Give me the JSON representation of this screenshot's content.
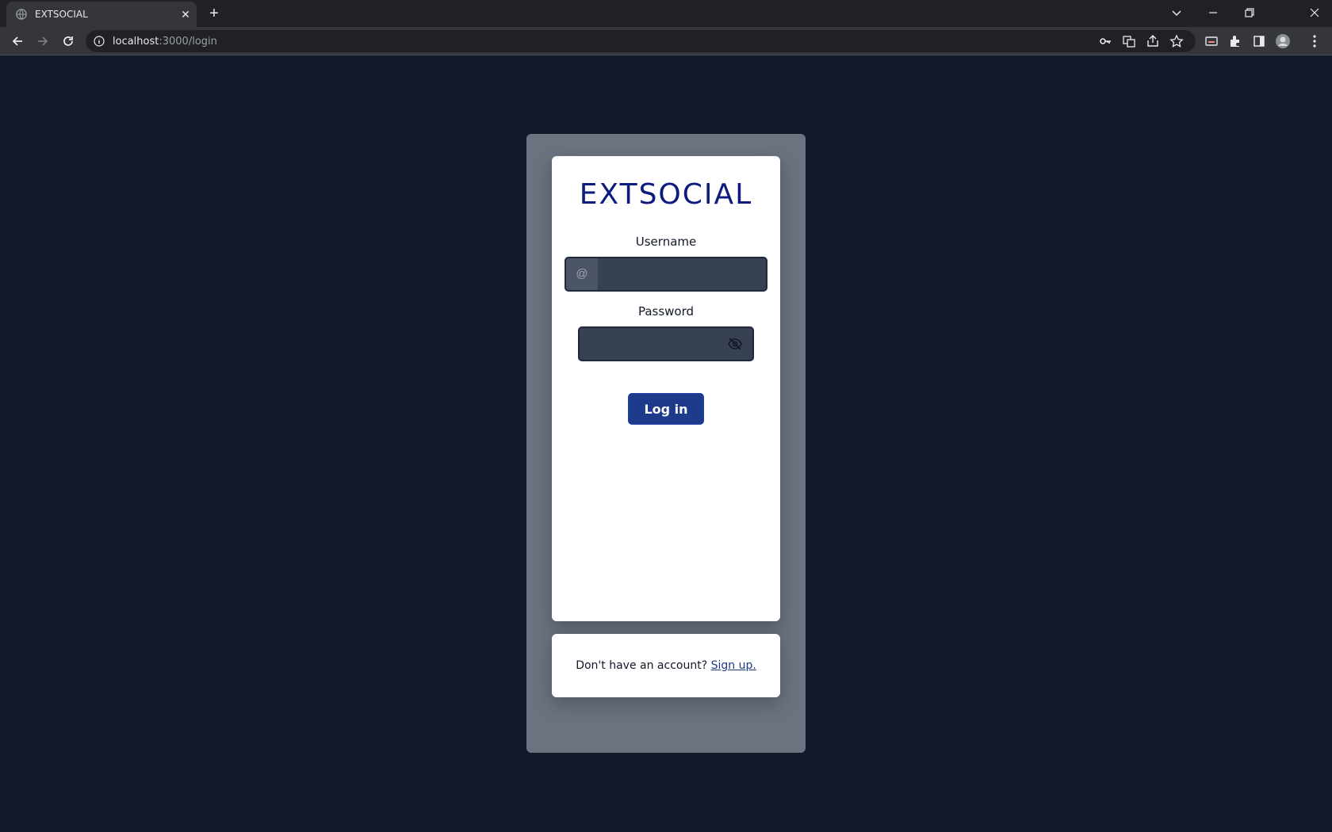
{
  "browser": {
    "tab_title": "EXTSOCIAL",
    "url_host": "localhost",
    "url_rest": ":3000/login",
    "icons": [
      "back-icon",
      "forward-icon",
      "reload-icon",
      "info-icon",
      "key-icon",
      "translate-icon",
      "share-icon",
      "star-icon",
      "cast-icon",
      "extensions-icon",
      "sidepanel-icon",
      "profile-avatar",
      "menu-icon"
    ]
  },
  "login": {
    "logo": "EXTSOCIAL",
    "username_label": "Username",
    "username_prefix": "@",
    "username_value": "",
    "password_label": "Password",
    "password_value": "",
    "login_button": "Log in"
  },
  "signup": {
    "prompt": "Don't have an account?",
    "link": "Sign up."
  },
  "colors": {
    "background": "#111827",
    "outer_panel": "#6b7280",
    "card": "#ffffff",
    "logo": "#0d1a80",
    "input_bg": "#374151",
    "button": "#1e3a8a"
  }
}
